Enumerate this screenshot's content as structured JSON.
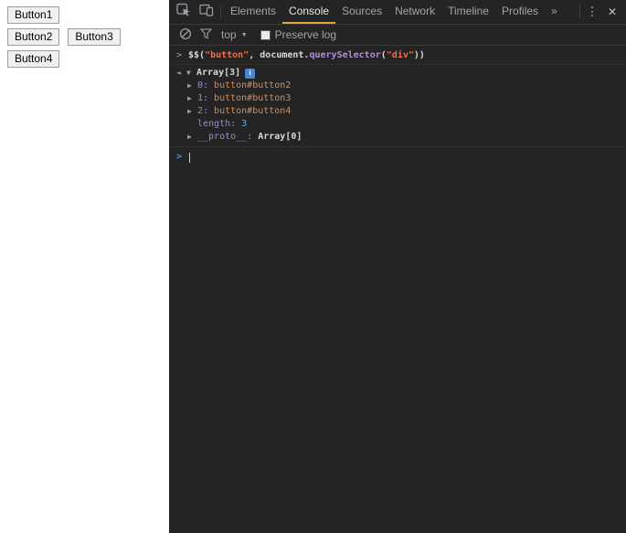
{
  "colors": {
    "devtools_background": "#242424",
    "active_tab_underline": "#e8a33d",
    "string_orange": "#e8734e",
    "method_purple": "#b58cd9",
    "property_purple": "#9f84d6",
    "node_value_orange": "#d08e5a",
    "number_blue": "#61a6e0",
    "input_prompt_blue": "#4a90e2"
  },
  "page": {
    "buttons": [
      {
        "label": "Button1"
      },
      {
        "label": "Button2"
      },
      {
        "label": "Button3"
      },
      {
        "label": "Button4"
      }
    ]
  },
  "devtools": {
    "main_toolbar": {
      "tabs": [
        "Elements",
        "Console",
        "Sources",
        "Network",
        "Timeline",
        "Profiles",
        "»"
      ],
      "active_tab": "Console",
      "menu_glyph": "⋮",
      "close_glyph": "✕"
    },
    "console_toolbar": {
      "frame_select": "top",
      "frame_select_arrow": "▼",
      "preserve_log": "Preserve log",
      "preserve_log_checked": false
    },
    "console": {
      "command": {
        "prompt": ">",
        "t1": "$$(",
        "t2": "\"button\"",
        "t3": ", document.",
        "t4": "querySelector",
        "t5": "(",
        "t6": "\"div\"",
        "t7": "))"
      },
      "result": {
        "return_arrow": "◄",
        "expander": "▼",
        "value": "Array[3]",
        "info_label": "i"
      },
      "items": [
        {
          "expander": "▶",
          "key": "0:",
          "value": "button#button2"
        },
        {
          "expander": "▶",
          "key": "1:",
          "value": "button#button3"
        },
        {
          "expander": "▶",
          "key": "2:",
          "value": "button#button4"
        }
      ],
      "length_row": {
        "key": "length:",
        "value": "3"
      },
      "proto_row": {
        "expander": "▶",
        "key": "__proto__:",
        "value": "Array[0]"
      },
      "input_prompt": ">"
    }
  }
}
